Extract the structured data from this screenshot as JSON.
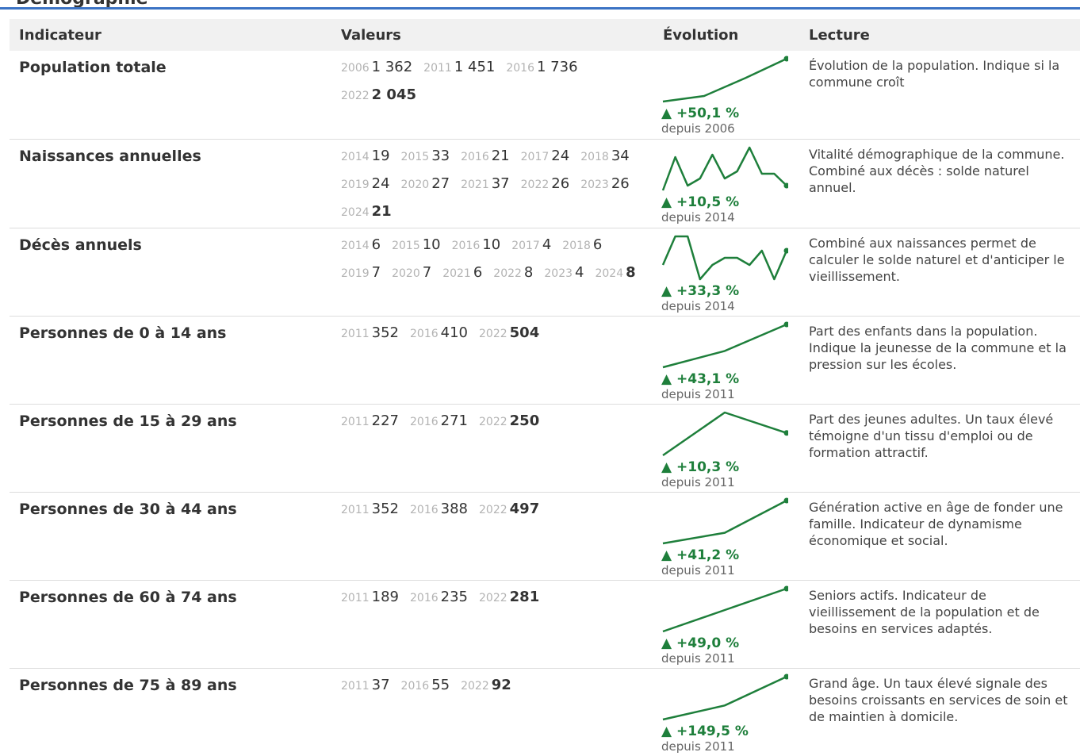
{
  "header": {
    "title": "Démographie"
  },
  "columns": {
    "indicator": "Indicateur",
    "values": "Valeurs",
    "evolution": "Évolution",
    "reading": "Lecture"
  },
  "rows": [
    {
      "name": "Population totale",
      "values": [
        {
          "year": "2006",
          "value": "1 362"
        },
        {
          "year": "2011",
          "value": "1 451"
        },
        {
          "year": "2016",
          "value": "1 736"
        },
        {
          "year": "2022",
          "value": "2 045"
        }
      ],
      "series": [
        1362,
        1451,
        1736,
        2045
      ],
      "change": "▲ +50,1 %",
      "since": "depuis 2006",
      "reading": "Évolution de la population. Indique si la commune croît"
    },
    {
      "name": "Naissances annuelles",
      "values": [
        {
          "year": "2014",
          "value": "19"
        },
        {
          "year": "2015",
          "value": "33"
        },
        {
          "year": "2016",
          "value": "21"
        },
        {
          "year": "2017",
          "value": "24"
        },
        {
          "year": "2018",
          "value": "34"
        },
        {
          "year": "2019",
          "value": "24"
        },
        {
          "year": "2020",
          "value": "27"
        },
        {
          "year": "2021",
          "value": "37"
        },
        {
          "year": "2022",
          "value": "26"
        },
        {
          "year": "2023",
          "value": "26"
        },
        {
          "year": "2024",
          "value": "21"
        }
      ],
      "series": [
        19,
        33,
        21,
        24,
        34,
        24,
        27,
        37,
        26,
        26,
        21
      ],
      "change": "▲ +10,5 %",
      "since": "depuis 2014",
      "reading": "Vitalité démographique de la commune. Combiné aux décès : solde naturel annuel."
    },
    {
      "name": "Décès annuels",
      "values": [
        {
          "year": "2014",
          "value": "6"
        },
        {
          "year": "2015",
          "value": "10"
        },
        {
          "year": "2016",
          "value": "10"
        },
        {
          "year": "2017",
          "value": "4"
        },
        {
          "year": "2018",
          "value": "6"
        },
        {
          "year": "2019",
          "value": "7"
        },
        {
          "year": "2020",
          "value": "7"
        },
        {
          "year": "2021",
          "value": "6"
        },
        {
          "year": "2022",
          "value": "8"
        },
        {
          "year": "2023",
          "value": "4"
        },
        {
          "year": "2024",
          "value": "8"
        }
      ],
      "series": [
        6,
        10,
        10,
        4,
        6,
        7,
        7,
        6,
        8,
        4,
        8
      ],
      "change": "▲ +33,3 %",
      "since": "depuis 2014",
      "reading": "Combiné aux naissances permet de calculer le solde naturel et d'anticiper le vieillissement."
    },
    {
      "name": "Personnes de 0 à 14 ans",
      "values": [
        {
          "year": "2011",
          "value": "352"
        },
        {
          "year": "2016",
          "value": "410"
        },
        {
          "year": "2022",
          "value": "504"
        }
      ],
      "series": [
        352,
        410,
        504
      ],
      "change": "▲ +43,1 %",
      "since": "depuis 2011",
      "reading": "Part des enfants dans la population. Indique la jeunesse de la commune et la pression sur les écoles."
    },
    {
      "name": "Personnes de 15 à 29 ans",
      "values": [
        {
          "year": "2011",
          "value": "227"
        },
        {
          "year": "2016",
          "value": "271"
        },
        {
          "year": "2022",
          "value": "250"
        }
      ],
      "series": [
        227,
        271,
        250
      ],
      "change": "▲ +10,3 %",
      "since": "depuis 2011",
      "reading": "Part des jeunes adultes. Un taux élevé témoigne d'un tissu d'emploi ou de formation attractif."
    },
    {
      "name": "Personnes de 30 à 44 ans",
      "values": [
        {
          "year": "2011",
          "value": "352"
        },
        {
          "year": "2016",
          "value": "388"
        },
        {
          "year": "2022",
          "value": "497"
        }
      ],
      "series": [
        352,
        388,
        497
      ],
      "change": "▲ +41,2 %",
      "since": "depuis 2011",
      "reading": "Génération active en âge de fonder une famille. Indicateur de dynamisme économique et social."
    },
    {
      "name": "Personnes de 60 à 74 ans",
      "values": [
        {
          "year": "2011",
          "value": "189"
        },
        {
          "year": "2016",
          "value": "235"
        },
        {
          "year": "2022",
          "value": "281"
        }
      ],
      "series": [
        189,
        235,
        281
      ],
      "change": "▲ +49,0 %",
      "since": "depuis 2011",
      "reading": "Seniors actifs. Indicateur de vieillissement de la population et de besoins en services adaptés."
    },
    {
      "name": "Personnes de 75 à 89 ans",
      "values": [
        {
          "year": "2011",
          "value": "37"
        },
        {
          "year": "2016",
          "value": "55"
        },
        {
          "year": "2022",
          "value": "92"
        }
      ],
      "series": [
        37,
        55,
        92
      ],
      "change": "▲ +149,5 %",
      "since": "depuis 2011",
      "reading": "Grand âge. Un taux élevé signale des besoins croissants en services de soin et de maintien à domicile."
    }
  ],
  "colors": {
    "accent": "#3b73c4",
    "positive": "#1e7f3b",
    "year": "#b3b3b3",
    "header_bg": "#f1f1f1"
  }
}
